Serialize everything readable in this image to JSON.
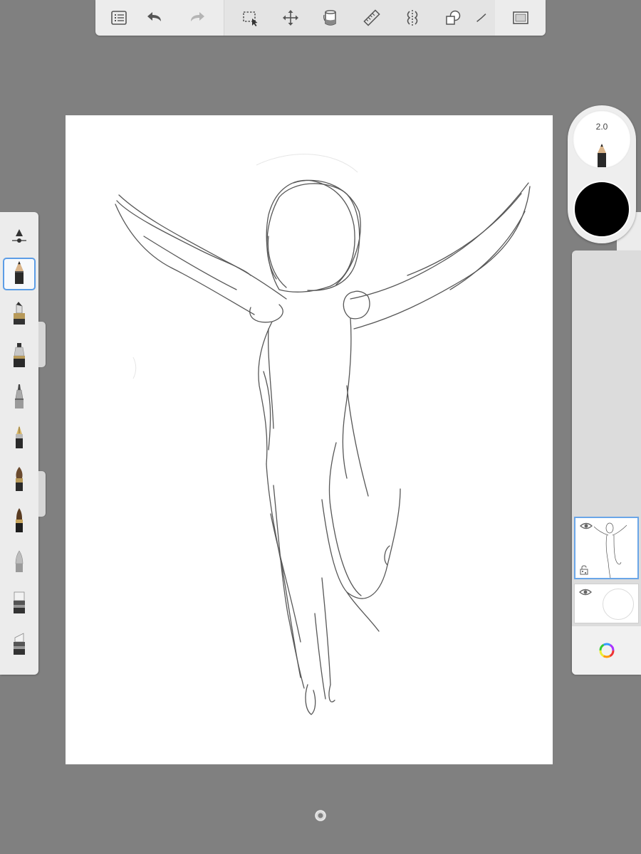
{
  "toolbar": {
    "icons": [
      "list-icon",
      "undo-icon",
      "redo-icon",
      "selection-icon",
      "transform-icon",
      "fill-icon",
      "ruler-icon",
      "symmetry-icon",
      "shapes-icon",
      "perspective-icon",
      "fullscreen-icon"
    ],
    "redo_enabled": false
  },
  "brush_palette": {
    "tools": [
      "brush-adjust-icon",
      "pencil-icon",
      "marker-icon",
      "ink-pen-icon",
      "airbrush-icon",
      "fountain-pen-icon",
      "paintbrush-icon",
      "watercolor-brush-icon",
      "smudge-icon",
      "eraser-icon",
      "soft-eraser-icon"
    ],
    "selected": "pencil-icon"
  },
  "puck": {
    "brush_size": "2.0",
    "color": "#000000"
  },
  "layers": {
    "items": [
      {
        "name": "sketch-layer",
        "visible": true,
        "selected": true,
        "locked": false
      },
      {
        "name": "background-layer",
        "visible": true,
        "selected": false
      }
    ]
  },
  "colors": {
    "background": "#808080",
    "panel": "#ececec",
    "accent": "#5c9de6",
    "canvas": "#ffffff"
  }
}
